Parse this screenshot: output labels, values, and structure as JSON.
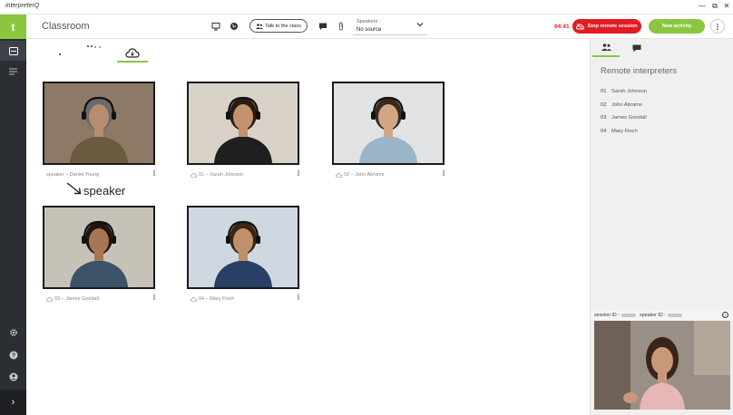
{
  "window": {
    "title": "interpreterQ",
    "minimize": "—",
    "maximize": "⧉",
    "close": "✕"
  },
  "header": {
    "page_title": "Classroom",
    "talk_label": "Talk to the class",
    "speakers_label": "Speakers :",
    "speakers_value": "No source",
    "timer": "04:41",
    "stop_label": "Stop remote session",
    "new_activity_label": "New activity"
  },
  "sidebar": {
    "logo": "t",
    "bottom_chevron": "›"
  },
  "tiles": [
    {
      "caption": "speaker – Daniel Young",
      "has_cloud": false,
      "skin": "#b88c6e",
      "hair": "#6a6a6a",
      "shirt": "#6a5a40",
      "bg": "#8c7a66"
    },
    {
      "caption": "01 – Sarah Johnson",
      "has_cloud": true,
      "skin": "#c4926f",
      "hair": "#2a1a12",
      "shirt": "#1f1f1f",
      "bg": "#d8d2c8"
    },
    {
      "caption": "02 – John Abrams",
      "has_cloud": true,
      "skin": "#d2a585",
      "hair": "#3a2a1e",
      "shirt": "#9ab4c8",
      "bg": "#e0e2e4"
    },
    {
      "caption": "03 – James Goodall",
      "has_cloud": true,
      "skin": "#a87655",
      "hair": "#1f1610",
      "shirt": "#3b5268",
      "bg": "#c7c2b8"
    },
    {
      "caption": "04 – Mary Finch",
      "has_cloud": true,
      "skin": "#c0906b",
      "hair": "#3a2414",
      "shirt": "#2a3f66",
      "bg": "#cfd8e0"
    }
  ],
  "annotation": {
    "text": "speaker"
  },
  "right_panel": {
    "title": "Remote interpreters",
    "interpreters": [
      {
        "num": "01",
        "name": "Sarah Johnson"
      },
      {
        "num": "02",
        "name": "John Abrams"
      },
      {
        "num": "03",
        "name": "James Goodall"
      },
      {
        "num": "04",
        "name": "Mary Finch"
      }
    ],
    "session_label": "session ID :",
    "speaker_id_label": "speaker ID :",
    "info": "i"
  },
  "colors": {
    "accent_green": "#8cc63f",
    "stop_red": "#e31b23",
    "sidebar_dark": "#2b2e33"
  }
}
